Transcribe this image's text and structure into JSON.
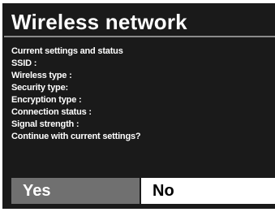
{
  "dialog": {
    "title": "Wireless network",
    "info_lines": [
      "Current settings and status",
      "SSID :",
      "Wireless type :",
      "Security type:",
      "Encryption type :",
      "Connection status :",
      "Signal strength :",
      "Continue with current settings?"
    ],
    "buttons": {
      "yes_label": "Yes",
      "no_label": "No"
    }
  },
  "colors": {
    "background": "#1a1a1a",
    "yes_button_bg": "#707070",
    "no_button_bg": "#ffffff"
  }
}
